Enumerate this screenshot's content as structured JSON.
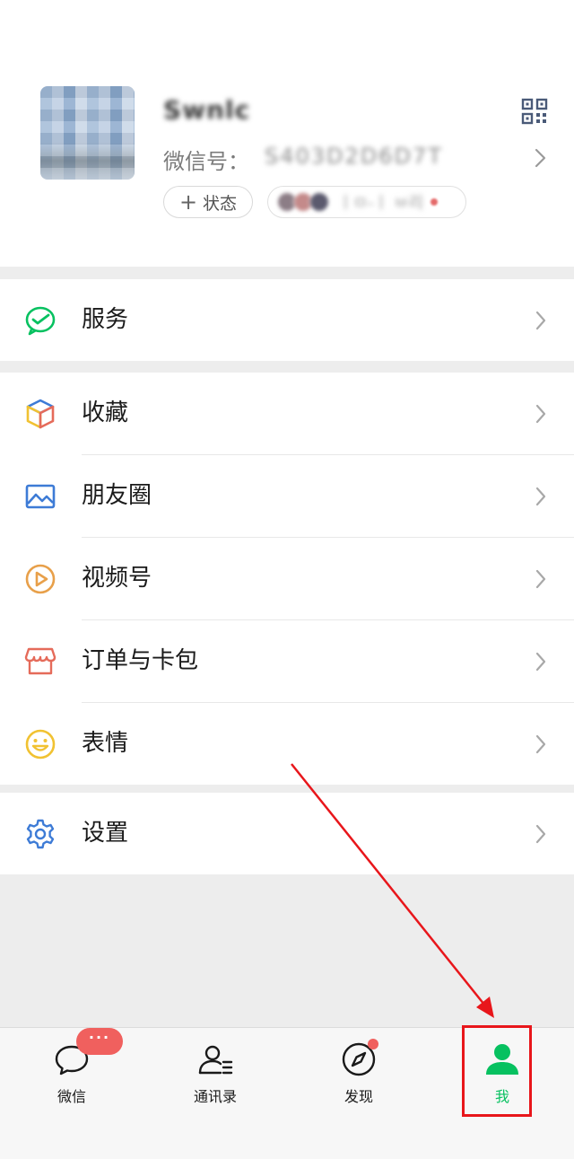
{
  "profile": {
    "nickname": "Swnlc",
    "wechat_id_label": "微信号：",
    "wechat_id_value": "S403D2D6D7T",
    "status_button": "状态",
    "status_plus": "+",
    "friends_status_text": "ㅣㅁ-ㅣ ㅂ리"
  },
  "menu": {
    "services": {
      "label": "服务"
    },
    "favorites": {
      "label": "收藏"
    },
    "moments": {
      "label": "朋友圈"
    },
    "channels": {
      "label": "视频号"
    },
    "orders": {
      "label": "订单与卡包"
    },
    "stickers": {
      "label": "表情"
    },
    "settings": {
      "label": "设置"
    }
  },
  "tabbar": {
    "chats": {
      "label": "微信",
      "badge": "···"
    },
    "contacts": {
      "label": "通讯录"
    },
    "discover": {
      "label": "发现"
    },
    "me": {
      "label": "我",
      "active": true
    }
  },
  "colors": {
    "accent_green": "#07c160",
    "badge_red": "#f0605e",
    "annotation_red": "#e8161b",
    "background": "#ededed",
    "icon_blue": "#3d7bd6",
    "icon_orange": "#e8a04a",
    "icon_red": "#e56b5a",
    "icon_yellow": "#f1c232"
  },
  "icons": {
    "avatar": "avatar-image",
    "qr": "qr-code-icon",
    "services": "wechat-pay-check-icon",
    "favorites": "cube-icon",
    "moments": "picture-icon",
    "channels": "play-circle-icon",
    "orders": "shop-awning-icon",
    "stickers": "smile-face-icon",
    "settings": "gear-icon",
    "chats": "chat-bubble-icon",
    "contacts": "contacts-person-icon",
    "discover": "compass-icon",
    "me": "person-icon"
  }
}
